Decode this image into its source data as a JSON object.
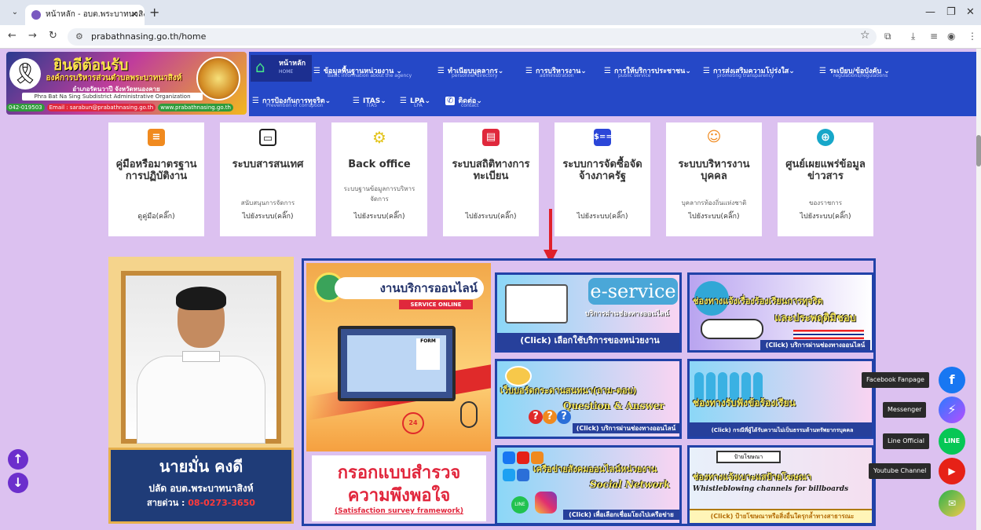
{
  "browser": {
    "tab_title": "หน้าหลัก - อบต.พระบาทนาสิงห์ อ.รั",
    "url": "prabathnasing.go.th/home"
  },
  "banner": {
    "welcome": "ยินดีต้อนรับ",
    "org_name": "องค์การบริหารส่วนตำบลพระบาทนาสิงห์",
    "amphoe": "อำเภอรัตนวาปี จังหวัดหนองคาย",
    "english_name": "Phra Bat Na Sing Subdistrict Administrative Organization",
    "phone": "042-019503",
    "email": "Email : sarabun@prabathnasing.go.th",
    "website": "www.prabathnasing.go.th"
  },
  "nav": {
    "items": [
      {
        "label": "หน้าหลัก",
        "sub": "HOME"
      },
      {
        "label": "ข้อมูลพื้นฐานหน่วยงาน",
        "sub": "Basic information about the agency"
      },
      {
        "label": "ทำเนียบบุคลากร",
        "sub": "personnel directory"
      },
      {
        "label": "การบริหารงาน",
        "sub": "administration"
      },
      {
        "label": "การให้บริการประชาชน",
        "sub": "public service"
      },
      {
        "label": "การส่งเสริมความโปร่งใส",
        "sub": "promoting transparency"
      },
      {
        "label": "ระเบียบ/ข้อบังคับ",
        "sub": "regulations/regulations"
      },
      {
        "label": "การป้องกันการทุจริต",
        "sub": "Prevention of corruption"
      },
      {
        "label": "ITAS",
        "sub": "ITAS"
      },
      {
        "label": "LPA",
        "sub": "LPA"
      },
      {
        "label": "ติดต่อ",
        "sub": "contact"
      }
    ]
  },
  "cards": [
    {
      "icon": "document-icon",
      "color": "#f08a1f",
      "title": "คู่มือหรือมาตรฐานการปฏิบัติงาน",
      "desc": "",
      "link": "ดูคู่มือ(คลิ๊ก)"
    },
    {
      "icon": "monitor-icon",
      "color": "#222222",
      "title": "ระบบสารสนเทศ",
      "desc": "สนับสนุนการจัดการ",
      "link": "ไปยังระบบ(คลิ๊ก)"
    },
    {
      "icon": "gears-icon",
      "color": "#e3c41b",
      "title": "Back office",
      "desc": "ระบบฐานข้อมูลการบริหารจัดการ",
      "link": "ไปยังระบบ(คลิ๊ก)"
    },
    {
      "icon": "id-card-icon",
      "color": "#e0283c",
      "title": "ระบบสถิติทางการทะเบียน",
      "desc": "",
      "link": "ไปยังระบบ(คลิ๊ก)"
    },
    {
      "icon": "money-icon",
      "color": "#2b46d8",
      "title": "ระบบการจัดซื้อจัดจ้างภาครัฐ",
      "desc": "",
      "link": "ไปยังระบบ(คลิ๊ก)"
    },
    {
      "icon": "people-icon",
      "color": "#f08a1f",
      "title": "ระบบบริหารงานบุคคล",
      "desc": "บุคลากรท้องถิ่นแห่งชาติ",
      "link": "ไปยังระบบ(คลิ๊ก)"
    },
    {
      "icon": "globe-icon",
      "color": "#17a7c9",
      "title": "ศูนย์เผยแพร่ข้อมูลข่าวสาร",
      "desc": "ของราชการ",
      "link": "ไปยังระบบ(คลิ๊ก)"
    }
  ],
  "official": {
    "name": "นายมั่น คงดี",
    "position": "ปลัด อบต.พระบาทนาสิงห์",
    "hotline_label": "สายด่วน :",
    "hotline": "08-0273-3650"
  },
  "online": {
    "title": "งานบริการออนไลน์",
    "subtitle": "SERVICE ONLINE",
    "form_label": "FORM",
    "clock_label": "24"
  },
  "survey": {
    "line1": "กรอกแบบสำรวจ",
    "line2": "ความพึงพอใจ",
    "line3": "(Satisfaction survey framework)"
  },
  "tiles": [
    {
      "head": "e-service",
      "sub": "บริการผ่านช่องทางออนไลน์",
      "bottom": "(Click) เลือกใช้บริการของหน่วยงาน"
    },
    {
      "head": "ช่องทางแจ้งเรื่องร้องเรียนการทุจริต",
      "sub": "และประพฤติมิชอบ",
      "bottom": "(Click) บริการผ่านช่องทางออนไลน์"
    },
    {
      "head": "เว็บบอร์ดกระดานสนทนา(ถาม-ตอบ)",
      "sub": "Question & Answer",
      "bottom": "(Click) บริการผ่านช่องทางออนไลน์"
    },
    {
      "head": "ช่องทางรับฟังข้อร้องเรียน",
      "sub": "",
      "bottom": "(Click) กรณีที่ผู้ได้รับความไม่เป็นธรรมด้านทรัพยากรบุคคล"
    },
    {
      "head": "เครือข่ายสังคมออนไลน์หน่วยงาน",
      "sub": "Social Network",
      "bottom": "(Click) เพื่อเลือกเชื่อมโยงไปเครือข่าย"
    },
    {
      "head": "ช่องทางแจ้งเบาะแสป้ายโฆษณา",
      "sub": "Whistleblowing channels for billboards",
      "bottom": "(Click) ป้ายโฆษณาหรือสิ่งอื่นใดรุกล้ำทางสาธารณะ",
      "board": "ป้ายโฆษณา"
    }
  ],
  "social": [
    {
      "label": "Facebook Fanpage",
      "icon": "facebook-icon",
      "color": "#1877f2",
      "glyph": "f"
    },
    {
      "label": "Messenger",
      "icon": "messenger-icon",
      "color": "#9b4dff",
      "glyph": "⚡"
    },
    {
      "label": "Line Official",
      "icon": "line-icon",
      "color": "#06c755",
      "glyph": "LINE"
    },
    {
      "label": "Youtube Channel",
      "icon": "youtube-icon",
      "color": "#e62117",
      "glyph": "▶"
    }
  ]
}
